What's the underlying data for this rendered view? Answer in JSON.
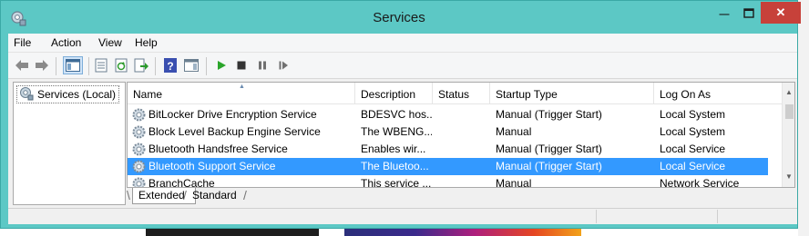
{
  "window": {
    "title": "Services",
    "close_glyph": "✕",
    "min_glyph": "—"
  },
  "menu": {
    "items": [
      "File",
      "Action",
      "View",
      "Help"
    ]
  },
  "toolbar": {
    "icons": [
      "back-arrow-icon",
      "forward-arrow-icon",
      "show-hide-console-tree-icon",
      "properties-icon",
      "refresh-icon",
      "export-list-icon",
      "help-icon",
      "show-hide-action-pane-icon",
      "start-service-icon",
      "stop-service-icon",
      "pause-service-icon",
      "restart-service-icon"
    ]
  },
  "tree": {
    "root_label": "Services (Local)"
  },
  "list": {
    "columns": [
      "Name",
      "Description",
      "Status",
      "Startup Type",
      "Log On As"
    ],
    "rows": [
      {
        "name": "BitLocker Drive Encryption Service",
        "description": "BDESVC hos...",
        "status": "",
        "startup_type": "Manual (Trigger Start)",
        "log_on_as": "Local System"
      },
      {
        "name": "Block Level Backup Engine Service",
        "description": "The WBENG...",
        "status": "",
        "startup_type": "Manual",
        "log_on_as": "Local System"
      },
      {
        "name": "Bluetooth Handsfree Service",
        "description": "Enables wir...",
        "status": "",
        "startup_type": "Manual (Trigger Start)",
        "log_on_as": "Local Service"
      },
      {
        "name": "Bluetooth Support Service",
        "description": "The Bluetoo...",
        "status": "",
        "startup_type": "Manual (Trigger Start)",
        "log_on_as": "Local Service"
      },
      {
        "name": "BranchCache",
        "description": "This service ...",
        "status": "",
        "startup_type": "Manual",
        "log_on_as": "Network Service"
      }
    ],
    "selected_row": 3
  },
  "tabs": {
    "extended": "Extended",
    "standard": "Standard"
  },
  "colors": {
    "window_frame": "#5cc8c5",
    "selection": "#3399ff",
    "close_button": "#c7413a"
  }
}
